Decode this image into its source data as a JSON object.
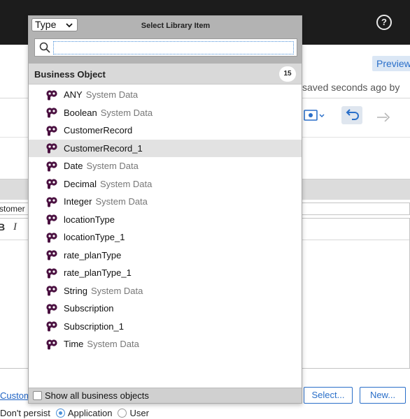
{
  "colors": {
    "accent": "#2a6fc9",
    "topbar": "#1c1c1c",
    "bo_icon": "#4a1040"
  },
  "app": {
    "help_icon": "?",
    "preview_label": "Preview",
    "saved_status": "saved seconds ago by",
    "name_field_value": "stomer",
    "bold_label": "B",
    "italic_label": "I",
    "custom_link": "Custom",
    "select_button": "Select...",
    "new_button": "New...",
    "persist": {
      "dont_persist": "Don't persist",
      "options": [
        {
          "label": "Application",
          "selected": true
        },
        {
          "label": "User",
          "selected": false
        }
      ]
    }
  },
  "popup": {
    "type_select": "Type",
    "title": "Select Library Item",
    "search": {
      "value": "",
      "placeholder": ""
    },
    "group": {
      "label": "Business Object",
      "count": "15"
    },
    "items": [
      {
        "name": "ANY",
        "tag": "System Data",
        "selected": false
      },
      {
        "name": "Boolean",
        "tag": "System Data",
        "selected": false
      },
      {
        "name": "CustomerRecord",
        "tag": "",
        "selected": false
      },
      {
        "name": "CustomerRecord_1",
        "tag": "",
        "selected": true
      },
      {
        "name": "Date",
        "tag": "System Data",
        "selected": false
      },
      {
        "name": "Decimal",
        "tag": "System Data",
        "selected": false
      },
      {
        "name": "Integer",
        "tag": "System Data",
        "selected": false
      },
      {
        "name": "locationType",
        "tag": "",
        "selected": false
      },
      {
        "name": "locationType_1",
        "tag": "",
        "selected": false
      },
      {
        "name": "rate_planType",
        "tag": "",
        "selected": false
      },
      {
        "name": "rate_planType_1",
        "tag": "",
        "selected": false
      },
      {
        "name": "String",
        "tag": "System Data",
        "selected": false
      },
      {
        "name": "Subscription",
        "tag": "",
        "selected": false
      },
      {
        "name": "Subscription_1",
        "tag": "",
        "selected": false
      },
      {
        "name": "Time",
        "tag": "System Data",
        "selected": false
      }
    ],
    "show_all_label": "Show all business objects",
    "show_all_checked": false
  }
}
